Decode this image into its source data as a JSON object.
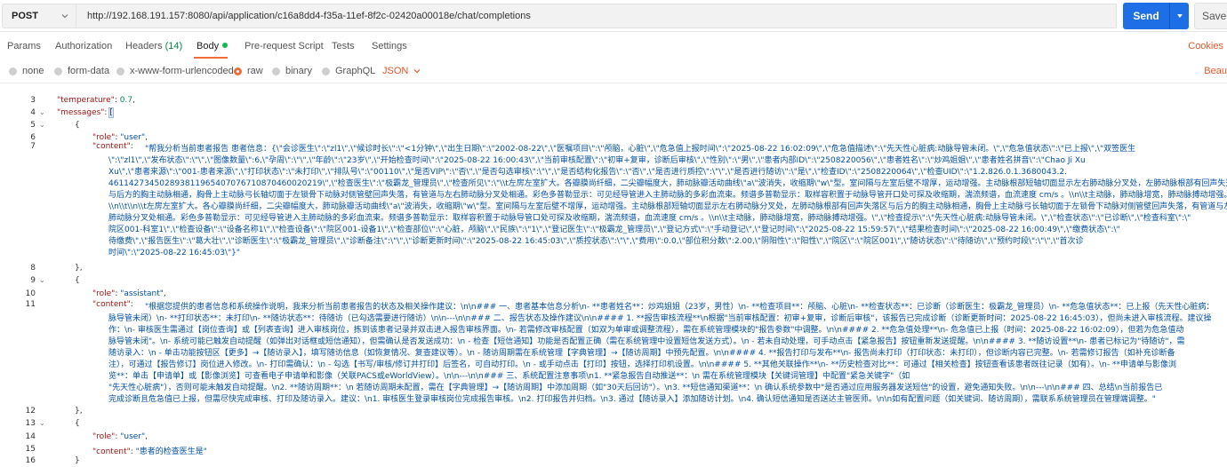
{
  "request": {
    "method": "POST",
    "url": "http://192.168.191.157:8080/api/application/c16a8dd4-f35a-11ef-8f2c-02420a00018e/chat/completions",
    "send_label": "Send",
    "save_label": "Save"
  },
  "tabs": {
    "params": "Params",
    "authorization": "Authorization",
    "headers": "Headers",
    "headers_count": "(14)",
    "body": "Body",
    "prerequest": "Pre-request Script",
    "tests": "Tests",
    "settings": "Settings",
    "cookies": "Cookies"
  },
  "body_options": {
    "none": "none",
    "form_data": "form-data",
    "urlencoded": "x-www-form-urlencoded",
    "raw": "raw",
    "binary": "binary",
    "graphql": "GraphQL",
    "format": "JSON",
    "beautify": "Beau"
  },
  "colors": {
    "accent": "#f26b3a",
    "send_blue": "#1e6ee6"
  },
  "editor": {
    "line_numbers": [
      "3",
      "4",
      "5",
      "6",
      "7",
      "8",
      "9",
      "10",
      "11",
      "12",
      "13",
      "14",
      "15",
      "16"
    ],
    "l3_key": "\"temperature\"",
    "l3_val": "0.7",
    "l4_key": "\"messages\"",
    "l6_key": "\"role\"",
    "l6_val": "\"user\"",
    "l7_key": "\"content\"",
    "l7_text": [
      "\"帮我分析当前患者报告  患者信息：{\\\"会诊医生\\\":\\\"zl1\\\",\\\"候诊时长\\\":\\\"<1分钟\\\",\\\"出生日期\\\":\\\"2002-08-22\\\",\\\"医嘱项目\\\":\\\"颅脑，心脏\\\",\\\"危急值上报时间\\\":\\\"2025-08-22 16:02:09\\\",\\\"危急值描述\\\":\\\"先天性心脏病:动脉导管未闭。\\\",\\\"危急值状态\\\":\\\"已上报\\\",\\\"双签医生",
      "\\\":\\\"zl1\\\",\\\"发布状态\\\":\\\"\\\",\\\"图像数量\\\":6,\\\"孕周\\\":\\\"\\\",\\\"年龄\\\":\\\"23岁\\\",\\\"开始检查时间\\\":\\\"2025-08-22 16:00:43\\\",\\\"当前审核配置\\\":\\\"初审+复审，诊断后审核\\\",\\\"性别\\\":\\\"男\\\",\\\"患者内部ID\\\":\\\"2508220056\\\",\\\"患者姓名\\\":\\\"炒鸡姐姐\\\",\\\"患者姓名拼音\\\":\\\"Chao Ji Xu",
      "Xu\\\",\\\"患者来源\\\":\\\"001-患者来源\\\",\\\"打印状态\\\":\\\"未打印\\\",\\\"排队号\\\":\\\"00110\\\",\\\"是否VIP\\\":\\\"否\\\",\\\"是否勾选审核\\\":\\\"\\\",\\\"是否结构化报告\\\":\\\"否\\\",\\\"是否进行质控\\\":\\\"\\\",\\\"是否进行随访\\\":\\\"是\\\",\\\"检查ID\\\":\\\"2508220064\\\",\\\"检查UID\\\":\\\"1.2.826.0.1.3680043.2.",
      "461142734502893811965407076710870460020219\\\",\\\"检查医生\\\":\\\"极霸龙_管理员\\\",\\\"检查所见\\\":\\\"\\\\t左房左室扩大。各瓣膜尚纤细，二尖瓣幅度大，肺动脉瓣活动曲线\\\"a\\\"波消失，收缩期\\\"w\\\"型。室间隔与左室后壁不增厚，运动增强。主动脉根部短轴切面显示左右肺动脉分叉处，左肺动脉根部有回声失落",
      "与后方的胸主动脉相通，胸骨上主动脉弓长轴切面于左锁骨下动脉对侧管壁回声失落，有管道与左右肺动脉分叉处相通。彩色多普勒显示：可见经导管进入主肺动脉的多彩血流束。频谱多普勒显示：取样容积置于动脉导管开口处可探及收缩期，湍流频谱，血流速度 cm/s 。\\\\n\\\\t主动脉，肺动脉增宽，肺动脉搏动增强。",
      "\\\\n\\\\t\\\\n\\\\t左房左室扩大。各心瓣膜尚纤细，二尖瓣幅度大，肺动脉瓣活动曲线\\\"a\\\"波消失，收缩期\\\"w\\\"型。室间隔与左室后壁不增厚，运动增强。主动脉根部短轴切面显示左右肺动脉分叉处，左肺动脉根部有回声失落区与后方的胸主动脉相通，胸骨上主动脉弓长轴切面于左锁骨下动脉对侧管壁回声失落，有管道与左右",
      "肺动脉分叉处相通。彩色多普勒显示：可见经导管进入主肺动脉的多彩血流束。频谱多普勒显示：取样容积置于动脉导管口处可探及收缩期，湍流频谱，血流速度 cm/s 。\\\\n\\\\t主动脉，肺动脉增宽，肺动脉搏动增强。\\\",\\\"检查提示\\\":\\\"先天性心脏病:动脉导管未闭。\\\",\\\"检查状态\\\":\\\"已诊断\\\",\\\"检查科室\\\":\\\"",
      "院区001-科室1\\\",\\\"检查设备\\\":\\\"设备名称1\\\",\\\"检查设备\\\":\\\"院区001-设备1\\\",\\\"检查部位\\\":\\\"心脏，颅脑\\\",\\\"民族\\\":\\\"1\\\",\\\"登记医生\\\":\\\"极霸龙_管理员\\\",\\\"登记方式\\\":\\\"手动登记\\\",\\\"登记时间\\\":\\\"2025-08-22 15:59:57\\\",\\\"结果检查时间\\\":\\\"2025-08-22 16:00:49\\\",\\\"缴费状态\\\":\\\"",
      "待缴费\\\",\\\"报告医生\\\":\\\"葛大壮\\\",\\\"诊断医生\\\":\\\"极霸龙_管理员\\\",\\\"诊断备注\\\":\\\"\\\",\\\"诊断更新时间\\\":\\\"2025-08-22 16:45:03\\\",\\\"质控状态\\\":\\\"\\\",\\\"费用\\\":0.0,\\\"部位积分数\\\":2.00,\\\"阴阳性\\\":\\\"阳性\\\",\\\"院区\\\":\\\"院区001\\\",\\\"随访状态\\\":\\\"待随访\\\",\\\"预约时段\\\":\\\"\\\",\\\"首次诊",
      "时间\\\":\\\"2025-08-22 16:45:03\\\"}\""
    ],
    "l10_key": "\"role\"",
    "l10_val": "\"assistant\"",
    "l11_key": "\"content\"",
    "l11_text": [
      "\"根据您提供的患者信息和系统操作说明，我来分析当前患者报告的状态及相关操作建议：\\n\\n### 一、患者基本信息分析\\n- **患者姓名**：炒鸡姐姐（23岁，男性）\\n- **检查项目**：颅脑、心脏\\n- **检查状态**：已诊断（诊断医生：极霸龙_管理员）\\n- **危急值状态**：已上报（先天性心脏病：",
      "脉导管未闭）\\n- **打印状态**：未打印\\n- **随访状态**：待随访（已勾选需要进行随访）\\n\\n---\\n\\n### 二、报告状态及操作建议\\n\\n#### 1. **报告审核流程**\\n根据\"当前审核配置：初审+复审，诊断后审核\"，该报告已完成诊断（诊断更新时间：2025-08-22 16:45:03），但尚未进入审核流程。建议操",
      "作：\\n- 审核医生需通过【岗位查询】或【列表查询】进入审核岗位，拣到该患者记录并双击进入报告审核界面。\\n- 若需修改审核配置（如双为单审或调整流程），需在系统管理模块的\"报告参数\"中调整。\\n\\n#### 2. **危急值处理**\\n- 危急值已上报（时间：2025-08-22 16:02:09），但若为危急值动",
      "脉导管未闭\"。\\n- 系统可能已触发自动提醒（如弹出对话框或短信通知），但需确认是否发送成功：\\n  - 检查【短信通知】功能是否配置正确（需在系统管理中设置短信发送方式）。\\n  - 若未自动处理，可手动点击【紧急报告】按钮重新发送提醒。\\n\\n#### 3. **随访设置**\\n- 患者已标记为\"待随访\"，需",
      "随访录入：\\n  - 单击功能按钮区【更多】→【随访录入】，填写随访信息（如恢复情况、复查建议等）。\\n  - 随访周期需在系统管理【字典管理】→【随访周期】中预先配置。\\n\\n#### 4. **报告打印与发布**\\n- 报告尚未打印（打印状态：未打印），但诊断内容已完整。\\n- 若需修订报告（如补充诊断备",
      "注），可通过【报告修订】岗位进入修改。\\n- 打印需确认：\\n  - 勾选【书写/审核/修订并打印】后签名，可自动打印。\\n  - 或手动点击【打印】按钮，选择打印机设置。\\n\\n#### 5. **其他关联操作**\\n- **历史检查对比**：可通过【相关检查】按钮查看该患者既往记录（如有）。\\n- **申请单与影像浏",
      "览**：单击【申请单】或【影像浏览】可查看电子申请单和影像（关联PACS或eWorldView）。\\n\\n---\\n\\n### 三、系统配置注意事项\\n1. **紧急报告自动推送**：\\n    需在系统管理模块【关键词管理】中配置\"紧急关键字\"（如",
      "\"先天性心脏病\"），否则可能未触发自动提醒。\\n2. **随访周期**：\\n    若随访周期未配置，需在【字典管理】→【随访周期】中添加周期（如\"30天后回访\"）。\\n3. **短信通知渠道**：\\n    确认系统参数中\"是否通过应用服务器发送短信\"的设置，避免通知失败。\\n\\n---\\n\\n### 四、总结\\n当前报告已",
      "完成诊断且危急值已上报，但需尽快完成审核、打印及随访录入。建议：\\n1. 审核医生登录审核岗位完成报告审核。\\n2. 打印报告并归档。\\n3. 通过【随访录入】添加随访计划。\\n4. 确认短信通知是否送达主管医师。\\n\\n如有配置问题（如关键词、随访周期），需联系系统管理员在管理端调整。\""
    ],
    "l15_key": "\"role\"",
    "l15_val": "\"user\"",
    "l16_key": "\"content\"",
    "l16_val": "\"患者的检查医生是\""
  }
}
